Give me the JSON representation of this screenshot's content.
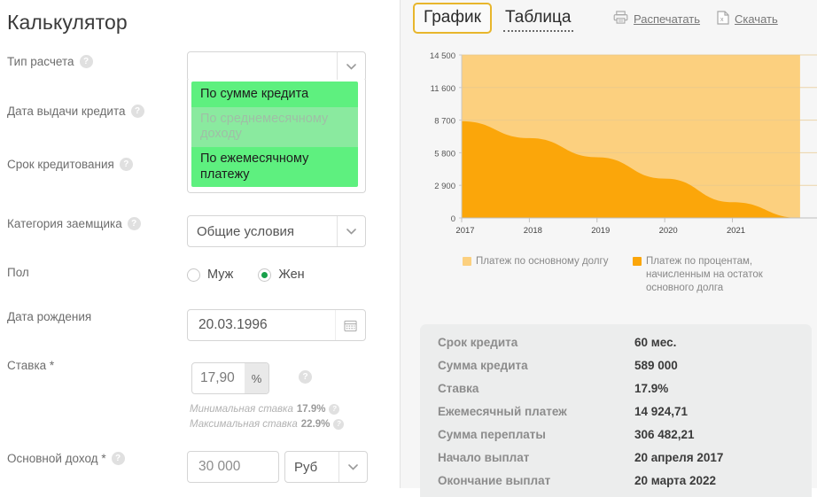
{
  "left": {
    "title": "Калькулятор",
    "fields": {
      "calc_type": {
        "label": "Тип расчета",
        "value": "",
        "help": "?"
      },
      "date_issue": {
        "label": "Дата выдачи кредита",
        "help": "?"
      },
      "term": {
        "label": "Срок кредитования",
        "help": "?"
      },
      "category": {
        "label": "Категория заемщика",
        "value": "Общие условия",
        "help": "?"
      },
      "gender": {
        "label": "Пол",
        "options": [
          "Муж",
          "Жен"
        ],
        "selected": "Жен"
      },
      "birth": {
        "label": "Дата рождения",
        "value": "20.03.1996"
      },
      "rate": {
        "label": "Ставка *",
        "value": "17,90",
        "suffix": "%",
        "help": "?"
      },
      "income": {
        "label": "Основной доход *",
        "value": "30 000",
        "currency": "Руб",
        "help": "?"
      }
    },
    "dropdown": {
      "items": [
        {
          "label": "По сумме кредита",
          "disabled": false
        },
        {
          "label": "По среднемесячному доходу",
          "disabled": true
        },
        {
          "label": "По ежемесячному платежу",
          "disabled": false
        }
      ]
    },
    "rate_notes": {
      "min_text": "Минимальная ставка",
      "min_value": "17.9%",
      "max_text": "Максимальная ставка",
      "max_value": "22.9%"
    },
    "icons": {
      "chevron": "chevron-down-icon",
      "calendar": "calendar-icon",
      "help": "help-icon"
    }
  },
  "right": {
    "tabs": [
      {
        "label": "График",
        "active": true
      },
      {
        "label": "Таблица",
        "active": false
      }
    ],
    "actions": [
      {
        "label": "Распечатать",
        "icon": "printer-icon"
      },
      {
        "label": "Скачать",
        "icon": "excel-file-icon"
      }
    ],
    "summary": {
      "rows": [
        {
          "label": "Срок кредита",
          "value": "60 мес."
        },
        {
          "label": "Сумма кредита",
          "value": "589 000"
        },
        {
          "label": "Ставка",
          "value": "17.9%"
        },
        {
          "label": "Ежемесячный платеж",
          "value": "14 924,71"
        },
        {
          "label": "Сумма переплаты",
          "value": "306 482,21"
        },
        {
          "label": "Начало выплат",
          "value": "20 апреля 2017"
        },
        {
          "label": "Окончание выплат",
          "value": "20 марта 2022"
        }
      ]
    }
  },
  "chart_data": {
    "type": "area",
    "stacked": true,
    "title": "",
    "xlabel": "",
    "ylabel": "",
    "grid": true,
    "legend_position": "bottom",
    "x": [
      2017,
      2018,
      2019,
      2020,
      2021,
      2022
    ],
    "xtick_labels": [
      "2017",
      "2018",
      "2019",
      "2020",
      "2021"
    ],
    "ytick_labels": [
      "0",
      "2 900",
      "5 800",
      "8 700",
      "11 600",
      "14 500"
    ],
    "ytick_values": [
      0,
      2900,
      5800,
      8700,
      11600,
      14500
    ],
    "ylim": [
      0,
      14500
    ],
    "xlim": [
      2017,
      2022.25
    ],
    "series": [
      {
        "name": "Платеж по процентам, начисленным на остаток основного долга",
        "color": "#fba60a",
        "values": [
          8600,
          7100,
          5400,
          3500,
          1400,
          0
        ]
      },
      {
        "name": "Платеж по основному долгу",
        "color": "#fcd07f",
        "values": [
          5900,
          7400,
          9100,
          11000,
          13100,
          14500
        ]
      }
    ],
    "legend": [
      {
        "label": "Платеж по основному долгу",
        "color": "#fcd07f"
      },
      {
        "label": "Платеж по процентам, начисленным на остаток основного долга",
        "color": "#fba60a"
      }
    ]
  }
}
